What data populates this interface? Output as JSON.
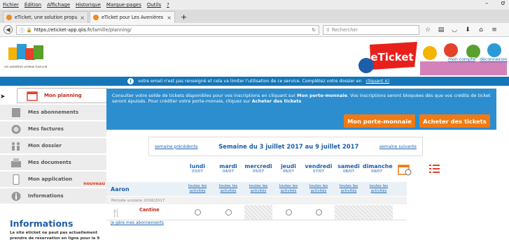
{
  "menubar": {
    "items": [
      "Fichier",
      "Édition",
      "Affichage",
      "Historique",
      "Marque-pages",
      "Outils",
      "?"
    ],
    "min": "–",
    "max": "ơ"
  },
  "tabs": [
    {
      "title": "eTicket, une solution propul",
      "close": "×"
    },
    {
      "title": "eTicket pour Les Avenières f",
      "close": "×"
    }
  ],
  "newtab": "+",
  "nav": {
    "url_host": "https://eticket-app.qiis.fr",
    "url_path": "/famille/planning/",
    "search_placeholder": "Rechercher"
  },
  "header": {
    "logo_sub": "LES AVENIÈRES VEYRINS-THUELLIN",
    "brand": "eTicket",
    "links": [
      "mon compte",
      "déconnexion"
    ]
  },
  "alert": {
    "text": "votre email n'est pas renseigné et cela va limiter l'utilisation de ce service. Complétez votre dossier en",
    "link": "cliquant ici"
  },
  "sidebar": {
    "items": [
      {
        "label": "Mon planning",
        "icon": "calendar-icon"
      },
      {
        "label": "Mes abonnements",
        "icon": "notebook-icon"
      },
      {
        "label": "Mes factures",
        "icon": "coin-icon"
      },
      {
        "label": "Mon dossier",
        "icon": "family-icon"
      },
      {
        "label": "Mes documents",
        "icon": "documents-icon"
      },
      {
        "label": "Mon application",
        "icon": "phone-icon",
        "badge": "nouveau"
      },
      {
        "label": "Informations",
        "icon": "info-icon"
      }
    ],
    "info_title": "Informations",
    "info_text": "Le site eticket ne peut pas actuellement prendre de réservation en ligne pour le 9"
  },
  "banner": {
    "line1_a": "Consulter votre solde de tickets disponibles pour vos inscriptions en cliquant sur ",
    "line1_b": "Mon porte-monnaie",
    "line1_c": ". Vos inscriptions seront bloquées dès que vos crédits de ticket seront épuisés. Pour créditer votre porte-monaie, cliquez sur ",
    "line1_d": "Acheter des tickets",
    "btn_porte": "Mon porte-monnaie",
    "btn_acheter": "Acheter des tickets"
  },
  "planning": {
    "prev": "semaine précédente",
    "next": "semaine suivante",
    "week_title": "Semaine du 3 juillet 2017 au 9 juillet 2017",
    "days": [
      {
        "name": "lundi",
        "date": "03/07"
      },
      {
        "name": "mardi",
        "date": "04/07"
      },
      {
        "name": "mercredi",
        "date": "05/07"
      },
      {
        "name": "jeudi",
        "date": "06/07"
      },
      {
        "name": "vendredi",
        "date": "07/07"
      },
      {
        "name": "samedi",
        "date": "08/07"
      },
      {
        "name": "dimanche",
        "date": "09/07"
      }
    ],
    "child": "Aaron",
    "toutes": "toutes les activités",
    "periode": "Période scolaire 2016/2017",
    "activity": "Cantine",
    "cells": [
      "circle",
      "circle",
      "hatch",
      "circle",
      "circle",
      "hatch",
      "hatch"
    ],
    "abon_link": "je gère mes abonnements"
  },
  "colors": {
    "accent_blue": "#2c8ecf",
    "orange": "#f07a13",
    "red_label": "#c02a1a"
  }
}
